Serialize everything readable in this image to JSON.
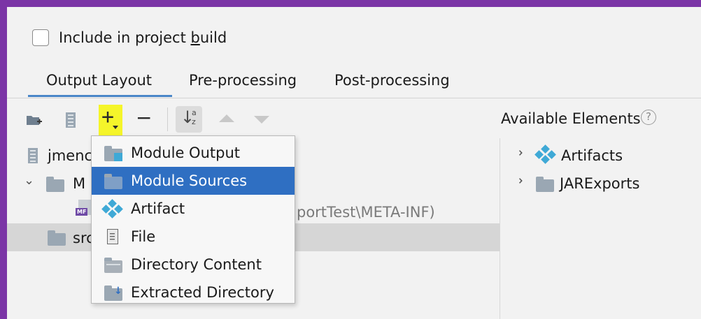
{
  "include_build": {
    "label_prefix": "Include in project ",
    "label_accel": "b",
    "label_suffix": "uild",
    "checked": false
  },
  "tabs": [
    {
      "label": "Output Layout",
      "active": true
    },
    {
      "label": "Pre-processing",
      "active": false
    },
    {
      "label": "Post-processing",
      "active": false
    }
  ],
  "toolbar": {
    "icons": [
      "create-directory-icon",
      "add-archive-icon",
      "add-icon",
      "remove-icon",
      "sort-icon",
      "move-up-icon",
      "move-down-icon"
    ],
    "highlight_color": "#f5f52a"
  },
  "available": {
    "title": "Available Elements",
    "help_glyph": "?",
    "items": [
      {
        "label": "Artifacts",
        "icon": "artifact-icon"
      },
      {
        "label": "JARExports",
        "icon": "module-folder-icon"
      }
    ]
  },
  "layout_tree": {
    "rows": [
      {
        "label": "jmenc",
        "icon": "jar-icon"
      },
      {
        "label": "M",
        "icon": "folder-icon",
        "expanded": true
      },
      {
        "label": "",
        "suffix": "portTest\\META-INF)",
        "icon": "manifest-icon",
        "badge": "MF"
      },
      {
        "label": "src",
        "icon": "folder-icon",
        "selected": true
      }
    ]
  },
  "menu": {
    "items": [
      {
        "label": "Module Output",
        "icon": "module-output-icon",
        "selected": false
      },
      {
        "label": "Module Sources",
        "icon": "module-sources-icon",
        "selected": true
      },
      {
        "label": "Artifact",
        "icon": "artifact-icon",
        "selected": false
      },
      {
        "label": "File",
        "icon": "file-icon",
        "selected": false
      },
      {
        "label": "Directory Content",
        "icon": "directory-content-icon",
        "selected": false
      },
      {
        "label": "Extracted Directory",
        "icon": "extracted-directory-icon",
        "selected": false
      }
    ],
    "selected_color": "#2f6fc2"
  },
  "colors": {
    "frame": "#7b35a6",
    "accent": "#4a86c8"
  }
}
